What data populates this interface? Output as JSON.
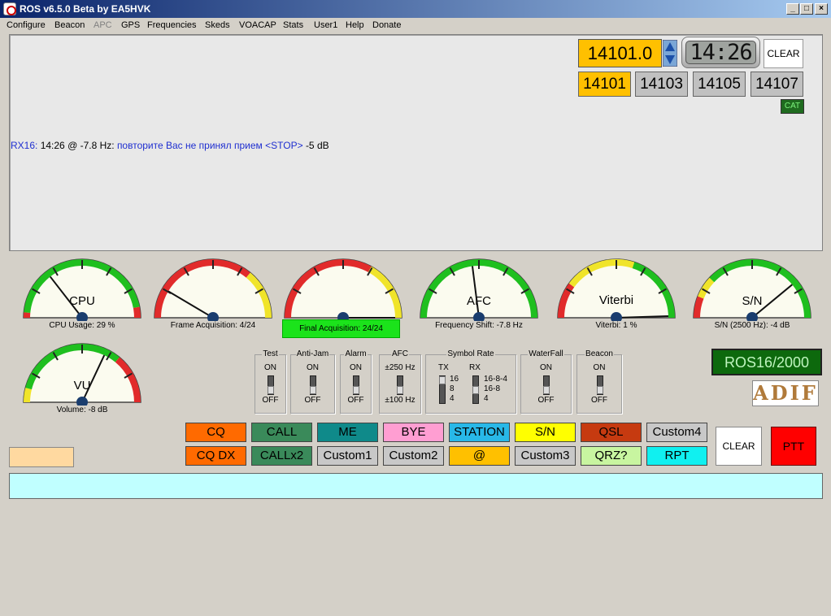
{
  "window": {
    "title": "ROS v6.5.0 Beta by EA5HVK"
  },
  "menu": [
    "Configure",
    "Beacon",
    "APC",
    "GPS",
    "Frequencies",
    "Skeds",
    "VOACAP",
    "Stats",
    "User1",
    "Help",
    "Donate"
  ],
  "menu_disabled": [
    "APC"
  ],
  "freq": {
    "current": "14101.0",
    "presets": [
      "14101",
      "14103",
      "14105",
      "14107"
    ],
    "active_preset": "14101"
  },
  "clock": "14:26",
  "clear_top": "CLEAR",
  "cat": "CAT",
  "rx": {
    "prefix": "RX16:",
    "time": "14:26 @ -7.8 Hz:",
    "text": "повторите Вас не принял прием <STOP>",
    "snr": "-5 dB"
  },
  "gauges": [
    {
      "label": "CPU",
      "caption": "CPU Usage: 29 %",
      "value": 29
    },
    {
      "label": "",
      "caption": "Frame Acquisition: 4/24",
      "value": 17
    },
    {
      "label": "",
      "caption": "Final Acquisition: 24/24",
      "value": 100
    },
    {
      "label": "AFC",
      "caption": "Frequency Shift: -7.8 Hz",
      "value": 46
    },
    {
      "label": "Viterbi",
      "caption": "Viterbi: 1 %",
      "value": 99
    },
    {
      "label": "S/N",
      "caption": "S/N (2500 Hz): -4 dB",
      "value": 78
    },
    {
      "label": "VU",
      "caption": "Volume: -8 dB",
      "value": 64
    }
  ],
  "switches": [
    {
      "title": "Test",
      "on": "ON",
      "off": "OFF"
    },
    {
      "title": "Anti-Jam",
      "on": "ON",
      "off": "OFF"
    },
    {
      "title": "Alarm",
      "on": "ON",
      "off": "OFF"
    },
    {
      "title": "AFC",
      "on": "±250 Hz",
      "off": "±100 Hz"
    },
    {
      "title": "WaterFall",
      "on": "ON",
      "off": "OFF"
    },
    {
      "title": "Beacon",
      "on": "ON",
      "off": "OFF"
    }
  ],
  "symbol_rate": {
    "title": "Symbol Rate",
    "tx_label": "TX",
    "rx_label": "RX",
    "tx_opts": [
      "16",
      "8",
      "4"
    ],
    "rx_opts": [
      "16-8-4",
      "16-8",
      "4"
    ]
  },
  "mode": "ROS16/2000",
  "adif": "ADIF",
  "macros": {
    "row1": [
      {
        "t": "CQ",
        "c": "#ff6a00"
      },
      {
        "t": "CALL",
        "c": "#3a8a5a"
      },
      {
        "t": "ME",
        "c": "#0f8a8a"
      },
      {
        "t": "BYE",
        "c": "#ff9ed2"
      },
      {
        "t": "STATION",
        "c": "#28b8e8"
      },
      {
        "t": "S/N",
        "c": "#ffff00"
      },
      {
        "t": "QSL",
        "c": "#c63a10"
      },
      {
        "t": "Custom4",
        "c": "#c8c8c8"
      }
    ],
    "row2": [
      {
        "t": "CQ DX",
        "c": "#ff6a00"
      },
      {
        "t": "CALLx2",
        "c": "#3a8a5a"
      },
      {
        "t": "Custom1",
        "c": "#c8c8c8"
      },
      {
        "t": "Custom2",
        "c": "#c8c8c8"
      },
      {
        "t": "@",
        "c": "#ffc000"
      },
      {
        "t": "Custom3",
        "c": "#c8c8c8"
      },
      {
        "t": "QRZ?",
        "c": "#c8f5a0"
      },
      {
        "t": "RPT",
        "c": "#10f0f0"
      }
    ]
  },
  "clear_bottom": "CLEAR",
  "ptt": "PTT"
}
